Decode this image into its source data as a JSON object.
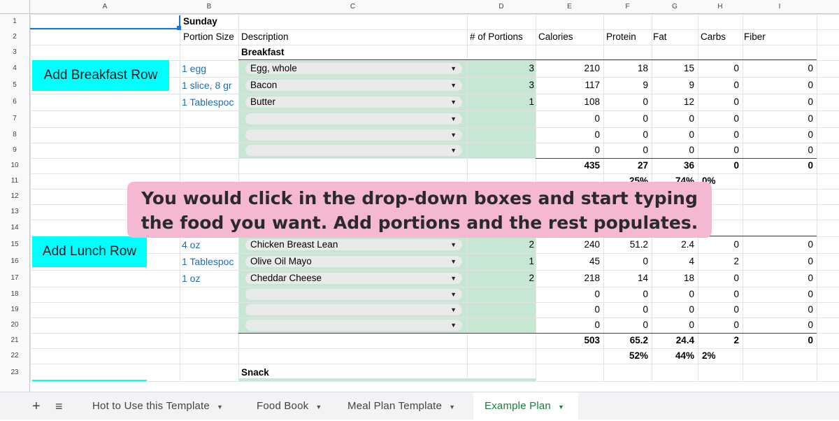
{
  "columns": [
    "A",
    "B",
    "C",
    "D",
    "E",
    "F",
    "G",
    "H",
    "I"
  ],
  "rows": [
    "1",
    "2",
    "3",
    "4",
    "5",
    "6",
    "7",
    "8",
    "9",
    "10",
    "11",
    "12",
    "13",
    "14",
    "15",
    "16",
    "17",
    "18",
    "19",
    "20",
    "21",
    "22",
    "23"
  ],
  "day": "Sunday",
  "headers": {
    "portion_size": "Portion Size",
    "description": "Description",
    "portions": "# of Portions",
    "calories": "Calories",
    "protein": "Protein",
    "fat": "Fat",
    "carbs": "Carbs",
    "fiber": "Fiber"
  },
  "breakfast": {
    "label": "Breakfast",
    "button": "Add Breakfast Row",
    "items": [
      {
        "portion_size": "1 egg",
        "description": "Egg, whole",
        "portions": "3",
        "calories": "210",
        "protein": "18",
        "fat": "15",
        "carbs": "0",
        "fiber": "0"
      },
      {
        "portion_size": "1 slice, 8 gr",
        "description": "Bacon",
        "portions": "3",
        "calories": "117",
        "protein": "9",
        "fat": "9",
        "carbs": "0",
        "fiber": "0"
      },
      {
        "portion_size": "1 Tablespoc",
        "description": "Butter",
        "portions": "1",
        "calories": "108",
        "protein": "0",
        "fat": "12",
        "carbs": "0",
        "fiber": "0"
      },
      {
        "portion_size": "",
        "description": "",
        "portions": "",
        "calories": "0",
        "protein": "0",
        "fat": "0",
        "carbs": "0",
        "fiber": "0"
      },
      {
        "portion_size": "",
        "description": "",
        "portions": "",
        "calories": "0",
        "protein": "0",
        "fat": "0",
        "carbs": "0",
        "fiber": "0"
      },
      {
        "portion_size": "",
        "description": "",
        "portions": "",
        "calories": "0",
        "protein": "0",
        "fat": "0",
        "carbs": "0",
        "fiber": "0"
      }
    ],
    "totals": {
      "calories": "435",
      "protein": "27",
      "fat": "36",
      "carbs": "0",
      "fiber": "0"
    },
    "percents": {
      "protein": "25%",
      "fat": "74%",
      "carbs": "0%"
    }
  },
  "lunch": {
    "button": "Add Lunch Row",
    "items": [
      {
        "portion_size": "4 oz",
        "description": "Chicken Breast Lean",
        "portions": "2",
        "calories": "240",
        "protein": "51.2",
        "fat": "2.4",
        "carbs": "0",
        "fiber": "0"
      },
      {
        "portion_size": "1 Tablespoc",
        "description": "Olive Oil Mayo",
        "portions": "1",
        "calories": "45",
        "protein": "0",
        "fat": "4",
        "carbs": "2",
        "fiber": "0"
      },
      {
        "portion_size": "1 oz",
        "description": "Cheddar Cheese",
        "portions": "2",
        "calories": "218",
        "protein": "14",
        "fat": "18",
        "carbs": "0",
        "fiber": "0"
      },
      {
        "portion_size": "",
        "description": "",
        "portions": "",
        "calories": "0",
        "protein": "0",
        "fat": "0",
        "carbs": "0",
        "fiber": "0"
      },
      {
        "portion_size": "",
        "description": "",
        "portions": "",
        "calories": "0",
        "protein": "0",
        "fat": "0",
        "carbs": "0",
        "fiber": "0"
      },
      {
        "portion_size": "",
        "description": "",
        "portions": "",
        "calories": "0",
        "protein": "0",
        "fat": "0",
        "carbs": "0",
        "fiber": "0"
      }
    ],
    "totals": {
      "calories": "503",
      "protein": "65.2",
      "fat": "24.4",
      "carbs": "2",
      "fiber": "0"
    },
    "percents": {
      "protein": "52%",
      "fat": "44%",
      "carbs": "2%"
    }
  },
  "snack": {
    "label": "Snack"
  },
  "overlay_text": "You would click in the drop-down boxes and start typing the food you want. Add portions and the rest populates.",
  "tabs": [
    {
      "label": "Hot to Use this Template",
      "active": false
    },
    {
      "label": "Food Book",
      "active": false
    },
    {
      "label": "Meal Plan Template",
      "active": false
    },
    {
      "label": "Example Plan",
      "active": true
    }
  ],
  "icons": {
    "add_sheet": "plus-icon",
    "all_sheets": "menu-list-icon",
    "dropdown": "triangle-down-icon"
  },
  "colors": {
    "button_bg": "#00ffff",
    "dropdown_column_bg": "#c6e7d2",
    "overlay_bg": "#f5b8d3",
    "active_tab": "#188038",
    "link_text": "#1c6fb2"
  }
}
